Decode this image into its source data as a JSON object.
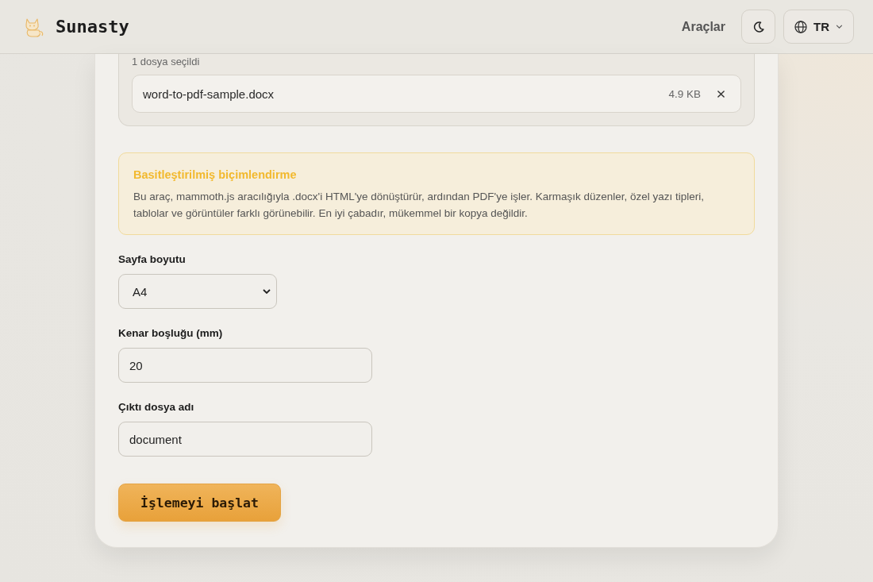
{
  "header": {
    "brand": "Sunasty",
    "nav_link": "Araçlar",
    "language": "TR"
  },
  "upload": {
    "selected_count": "1 dosya seçildi",
    "files": [
      {
        "name": "word-to-pdf-sample.docx",
        "size": "4.9 KB"
      }
    ]
  },
  "notice": {
    "title": "Basitleştirilmiş biçimlendirme",
    "text": "Bu araç, mammoth.js aracılığıyla .docx'i HTML'ye dönüştürür, ardından PDF'ye işler. Karmaşık düzenler, özel yazı tipleri, tablolar ve görüntüler farklı görünebilir. En iyi çabadır, mükemmel bir kopya değildir."
  },
  "form": {
    "fields": [
      {
        "kind": "select",
        "label": "Sayfa boyutu",
        "value": "A4"
      },
      {
        "kind": "input",
        "label": "Kenar boşluğu (mm)",
        "value": "20"
      },
      {
        "kind": "input",
        "label": "Çıktı dosya adı",
        "value": "document"
      }
    ]
  },
  "submit_button": "İşlemeyi başlat"
}
